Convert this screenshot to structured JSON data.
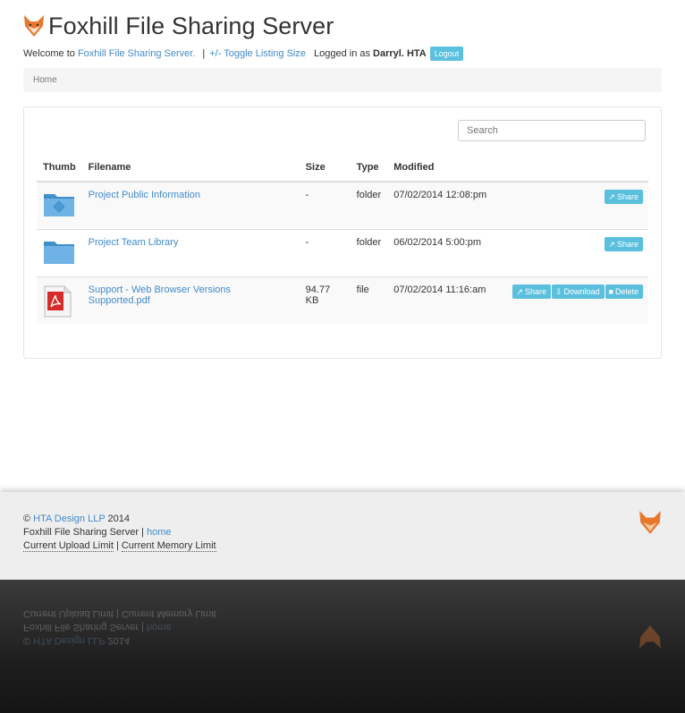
{
  "app": {
    "title": "Foxhill File Sharing Server"
  },
  "welcome": {
    "prefix": "Welcome to",
    "site_link": "Foxhill File Sharing Server.",
    "separator": "|",
    "toggle_link": "+/- Toggle Listing Size",
    "logged_in_prefix": "Logged in as",
    "user": "Darryl. HTA",
    "logout_label": "Logout"
  },
  "breadcrumb": {
    "home": "Home"
  },
  "search": {
    "placeholder": "Search"
  },
  "table": {
    "headers": {
      "thumb": "Thumb",
      "filename": "Filename",
      "size": "Size",
      "type": "Type",
      "modified": "Modified"
    },
    "rows": [
      {
        "filename": "Project Public Information",
        "size": "-",
        "type": "folder",
        "modified": "07/02/2014 12:08:pm",
        "share_label": "Share"
      },
      {
        "filename": "Project Team Library",
        "size": "-",
        "type": "folder",
        "modified": "06/02/2014 5:00:pm",
        "share_label": "Share"
      },
      {
        "filename": "Support - Web Browser Versions Supported.pdf",
        "size": "94.77 KB",
        "type": "file",
        "modified": "07/02/2014 11:16:am",
        "share_label": "Share",
        "download_label": "Download",
        "delete_label": "Delete"
      }
    ]
  },
  "footer": {
    "copyright_symbol": "©",
    "company_link": "HTA Design LLP",
    "year": "2014",
    "server_name": "Foxhill File Sharing Server",
    "separator": "|",
    "home_link": "home",
    "upload_limit": "Current Upload Limit",
    "memory_limit": "Current Memory Limit"
  },
  "colors": {
    "link": "#428bca",
    "button_info": "#5bc0de",
    "fox_orange": "#e8772e"
  },
  "icons": {
    "logo": "fox-head-icon",
    "share": "share-icon",
    "download": "download-icon",
    "delete": "trash-icon",
    "folder": "folder-icon",
    "pdf": "pdf-file-icon"
  }
}
